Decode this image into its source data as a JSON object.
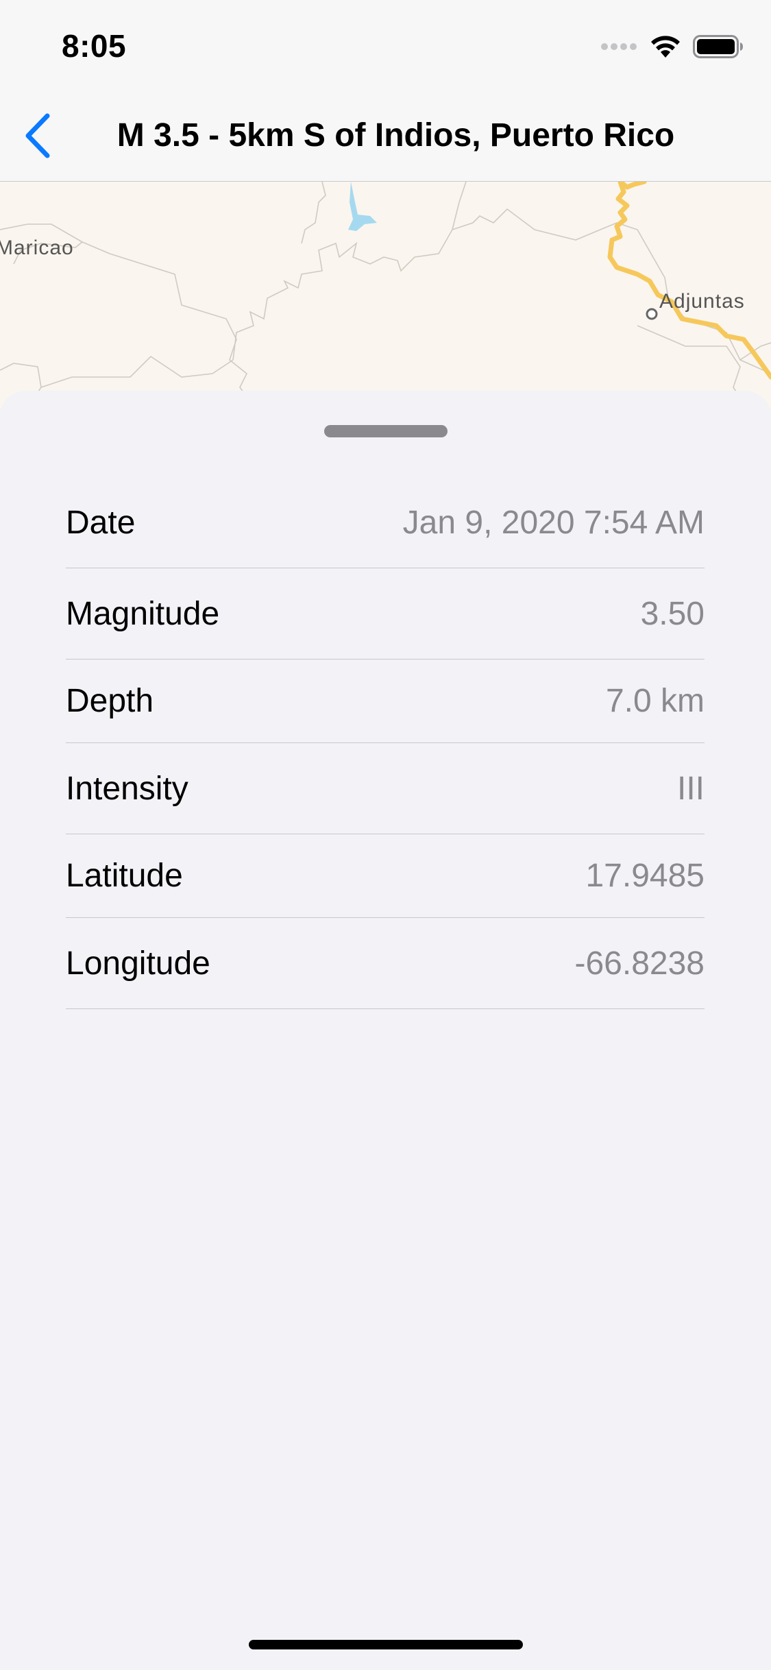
{
  "status_bar": {
    "time": "8:05",
    "icons": [
      "signal-dots-icon",
      "wifi-icon",
      "battery-icon"
    ]
  },
  "nav": {
    "back_icon": "chevron-left-icon",
    "title": "M 3.5 - 5km S of Indios, Puerto Rico",
    "accent_color": "#0a7aff"
  },
  "map": {
    "labels": {
      "maricao": "Maricao",
      "adjuntas": "Adjuntas"
    }
  },
  "details": {
    "rows": [
      {
        "label": "Date",
        "value": "Jan 9, 2020 7:54 AM"
      },
      {
        "label": "Magnitude",
        "value": "3.50"
      },
      {
        "label": "Depth",
        "value": "7.0 km"
      },
      {
        "label": "Intensity",
        "value": "III"
      },
      {
        "label": "Latitude",
        "value": "17.9485"
      },
      {
        "label": "Longitude",
        "value": "-66.8238"
      }
    ]
  }
}
